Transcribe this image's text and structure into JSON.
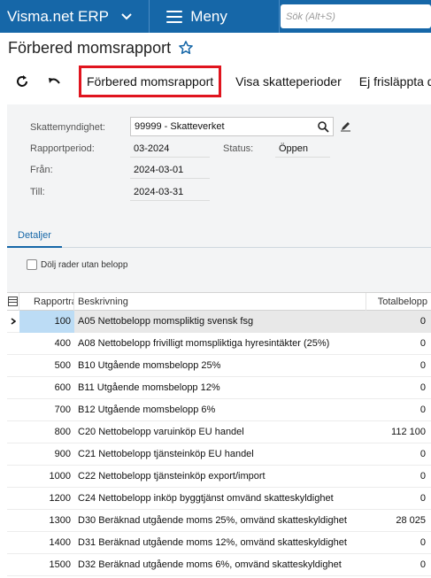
{
  "topbar": {
    "brand": "Visma.net ERP",
    "menu_label": "Meny",
    "search_placeholder": "Sök (Alt+S)"
  },
  "page": {
    "title": "Förbered momsrapport"
  },
  "toolbar": {
    "refresh_icon": "refresh-icon",
    "undo_icon": "undo-icon",
    "prepare_label": "Förbered momsrapport",
    "show_periods_label": "Visa skatteperioder",
    "unreleased_label": "Ej frisläppta dokument"
  },
  "form": {
    "authority_label": "Skattemyndighet:",
    "authority_value": "99999 - Skatteverket",
    "period_label": "Rapportperiod:",
    "period_value": "03-2024",
    "status_label": "Status:",
    "status_value": "Öppen",
    "from_label": "Från:",
    "from_value": "2024-03-01",
    "to_label": "Till:",
    "to_value": "2024-03-31"
  },
  "tabs": {
    "details": "Detaljer"
  },
  "options": {
    "hide_zero_rows": "Dölj rader utan belopp"
  },
  "grid": {
    "col_report": "Rapportrad",
    "col_desc": "Beskrivning",
    "col_total": "Totalbelopp",
    "rows": [
      {
        "line": "100",
        "desc": "A05 Nettobelopp momspliktig svensk fsg",
        "total": "0"
      },
      {
        "line": "400",
        "desc": "A08 Nettobelopp frivilligt momspliktiga hyresintäkter (25%)",
        "total": "0"
      },
      {
        "line": "500",
        "desc": "B10 Utgående momsbelopp 25%",
        "total": "0"
      },
      {
        "line": "600",
        "desc": "B11 Utgående momsbelopp 12%",
        "total": "0"
      },
      {
        "line": "700",
        "desc": "B12 Utgående momsbelopp 6%",
        "total": "0"
      },
      {
        "line": "800",
        "desc": "C20 Nettobelopp varuinköp EU handel",
        "total": "112 100"
      },
      {
        "line": "900",
        "desc": "C21 Nettobelopp tjänsteinköp EU handel",
        "total": "0"
      },
      {
        "line": "1000",
        "desc": "C22 Nettobelopp tjänsteinköp export/import",
        "total": "0"
      },
      {
        "line": "1200",
        "desc": "C24 Nettobelopp inköp byggtjänst omvänd skatteskyldighet",
        "total": "0"
      },
      {
        "line": "1300",
        "desc": "D30 Beräknad utgående moms 25%, omvänd skatteskyldighet",
        "total": "28 025"
      },
      {
        "line": "1400",
        "desc": "D31 Beräknad utgående moms 12%, omvänd skatteskyldighet",
        "total": "0"
      },
      {
        "line": "1500",
        "desc": "D32 Beräknad utgående moms 6%, omvänd skatteskyldighet",
        "total": "0"
      }
    ]
  },
  "colors": {
    "topbar": "#1667a8",
    "highlight": "#e0141e",
    "selected_cell": "#bcdcf5"
  }
}
